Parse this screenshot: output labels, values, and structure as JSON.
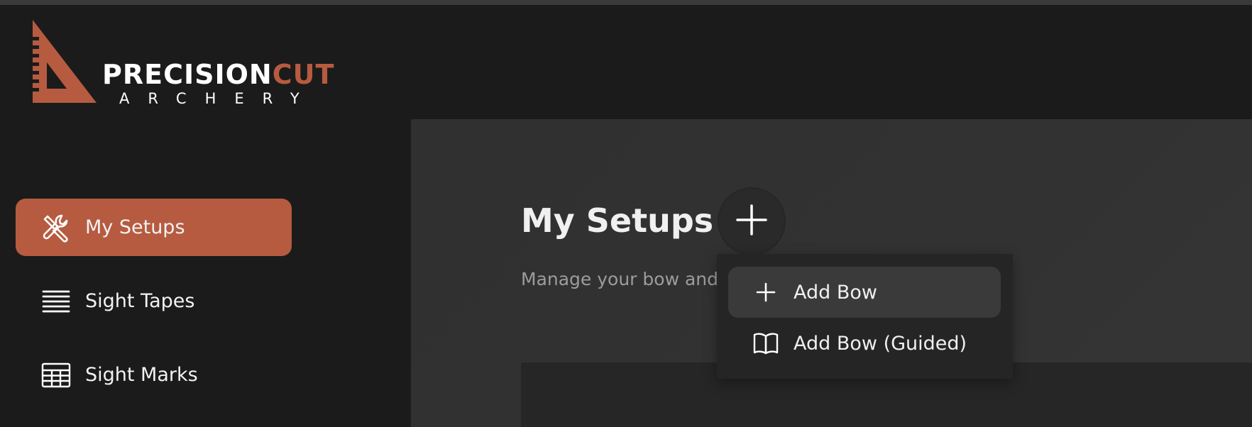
{
  "brand": {
    "word_main": "PRECISION",
    "word_accent": "CUT",
    "word_sub": "ARCHERY",
    "accent_color": "#b65b40"
  },
  "sidebar": {
    "items": [
      {
        "label": "My Setups",
        "icon": "tools-icon",
        "active": true
      },
      {
        "label": "Sight Tapes",
        "icon": "lines-icon",
        "active": false
      },
      {
        "label": "Sight Marks",
        "icon": "table-icon",
        "active": false
      }
    ]
  },
  "main": {
    "title": "My Setups",
    "subtitle": "Manage your bow and"
  },
  "add_menu": {
    "items": [
      {
        "label": "Add Bow",
        "icon": "plus-icon"
      },
      {
        "label": "Add Bow (Guided)",
        "icon": "book-icon"
      }
    ]
  }
}
